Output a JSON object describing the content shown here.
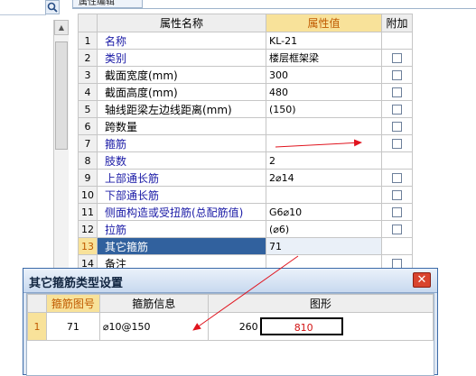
{
  "property_panel": {
    "tab_label": "属性编辑",
    "columns": {
      "index": "",
      "name": "属性名称",
      "value": "属性值",
      "extra": "附加"
    },
    "rows": [
      {
        "index": "1",
        "name": "名称",
        "value": "KL-21",
        "blue": true,
        "checkbox": false
      },
      {
        "index": "2",
        "name": "类别",
        "value": "楼层框架梁",
        "blue": true,
        "checkbox": true
      },
      {
        "index": "3",
        "name": "截面宽度(mm)",
        "value": "300",
        "blue": false,
        "checkbox": true
      },
      {
        "index": "4",
        "name": "截面高度(mm)",
        "value": "480",
        "blue": false,
        "checkbox": true
      },
      {
        "index": "5",
        "name": "轴线距梁左边线距离(mm)",
        "value": "(150)",
        "blue": false,
        "checkbox": true
      },
      {
        "index": "6",
        "name": "跨数量",
        "value": "",
        "blue": false,
        "checkbox": true
      },
      {
        "index": "7",
        "name": "箍筋",
        "value": "",
        "blue": true,
        "checkbox": true
      },
      {
        "index": "8",
        "name": "肢数",
        "value": "2",
        "blue": true,
        "checkbox": false
      },
      {
        "index": "9",
        "name": "上部通长筋",
        "value": "2⌀14",
        "blue": true,
        "checkbox": true
      },
      {
        "index": "10",
        "name": "下部通长筋",
        "value": "",
        "blue": true,
        "checkbox": true
      },
      {
        "index": "11",
        "name": "侧面构造或受扭筋(总配筋值)",
        "value": "G6⌀10",
        "blue": true,
        "checkbox": true
      },
      {
        "index": "12",
        "name": "拉筋",
        "value": "(⌀6)",
        "blue": true,
        "checkbox": true
      },
      {
        "index": "13",
        "name": "其它箍筋",
        "value": "71",
        "blue": false,
        "checkbox": false,
        "selected": true
      },
      {
        "index": "14",
        "name": "备注",
        "value": "",
        "blue": false,
        "checkbox": true
      }
    ]
  },
  "dialog": {
    "title": "其它箍筋类型设置",
    "close_label": "✕",
    "columns": {
      "index": "",
      "code": "箍筋图号",
      "info": "箍筋信息",
      "shape": "图形"
    },
    "rows": [
      {
        "index": "1",
        "code": "71",
        "info": "⌀10@150",
        "shape_left": "260",
        "shape_inner": "810"
      }
    ]
  },
  "colors": {
    "selected_row": "#31619e",
    "value_header": "#f8e29a",
    "annotation_arrow": "#e0141e",
    "close_button": "#d9442e"
  },
  "icons": {
    "search": "magnifier-icon",
    "close": "close-icon",
    "scroll_up": "scroll-up-arrow-icon"
  }
}
